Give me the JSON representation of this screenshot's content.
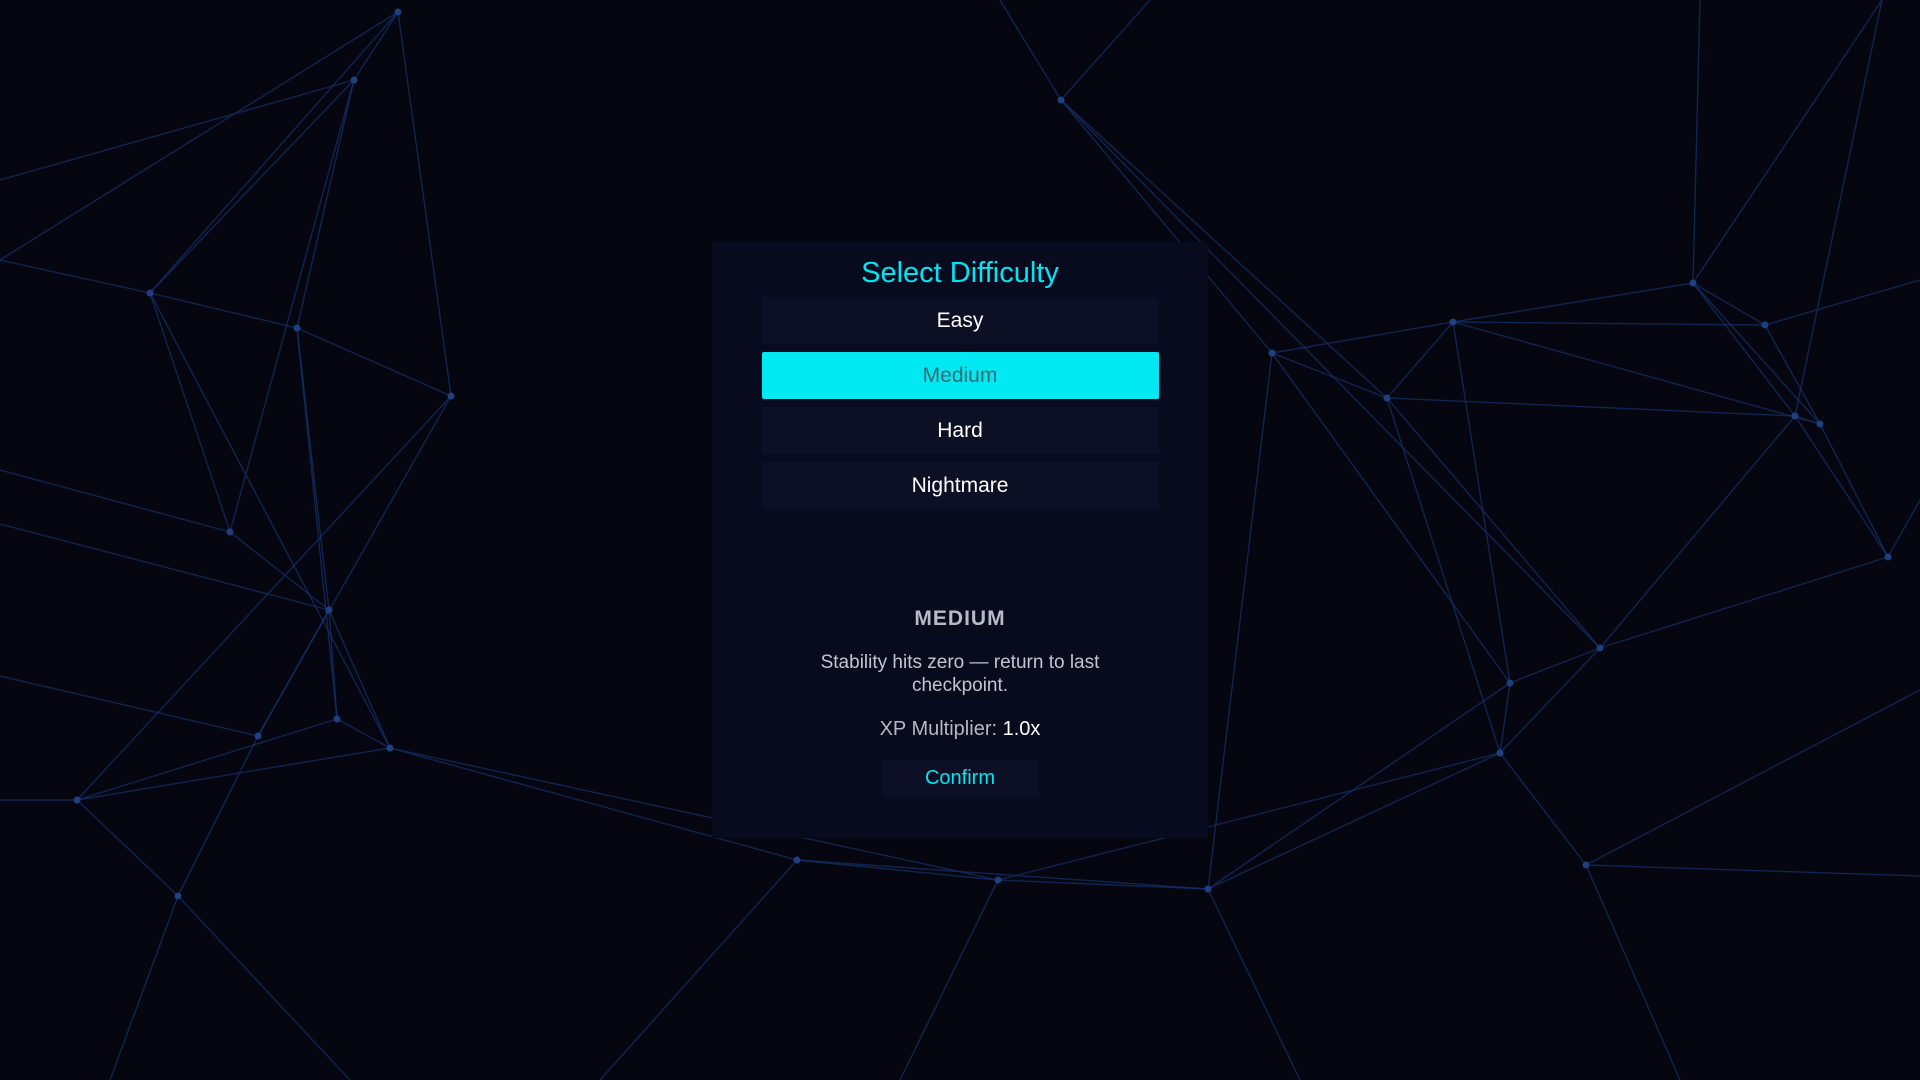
{
  "dialog": {
    "title": "Select Difficulty",
    "options": [
      {
        "label": "Easy"
      },
      {
        "label": "Medium",
        "selected": true
      },
      {
        "label": "Hard"
      },
      {
        "label": "Nightmare"
      }
    ],
    "detail": {
      "name": "MEDIUM",
      "description": "Stability hits zero — return to last checkpoint.",
      "xp_label": "XP Multiplier:",
      "xp_value": "1.0x"
    },
    "confirm_label": "Confirm"
  },
  "colors": {
    "background": "#05060f",
    "panel": "#080a1e",
    "accent": "#00e5f2",
    "network_line": "#13306a",
    "network_node": "#1f3f80"
  }
}
